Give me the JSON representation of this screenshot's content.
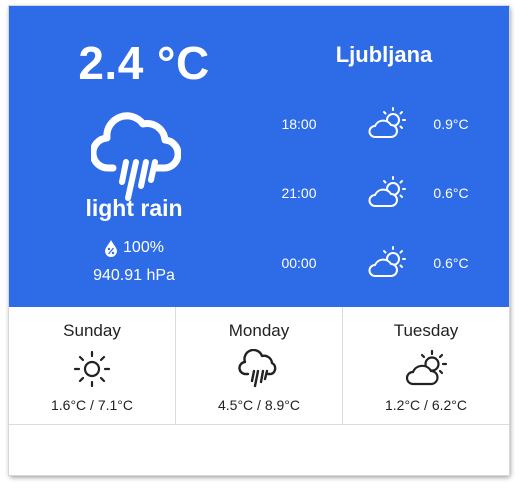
{
  "current": {
    "temperature": "2.4 °C",
    "condition": "light rain",
    "condition_icon": "cloud-rain-icon",
    "humidity": "100%",
    "humidity_icon": "humidity-drop-icon",
    "pressure": "940.91 hPa"
  },
  "location": {
    "city": "Ljubljana"
  },
  "hourly": [
    {
      "time": "18:00",
      "icon": "partly-cloudy-icon",
      "temp": "0.9°C"
    },
    {
      "time": "21:00",
      "icon": "partly-cloudy-icon",
      "temp": "0.6°C"
    },
    {
      "time": "00:00",
      "icon": "partly-cloudy-icon",
      "temp": "0.6°C"
    }
  ],
  "daily": [
    {
      "day": "Sunday",
      "icon": "sun-icon",
      "range": "1.6°C / 7.1°C"
    },
    {
      "day": "Monday",
      "icon": "cloud-rain-icon",
      "range": "4.5°C / 8.9°C"
    },
    {
      "day": "Tuesday",
      "icon": "partly-cloudy-icon",
      "range": "1.2°C / 6.2°C"
    }
  ],
  "colors": {
    "accent": "#2e6be6",
    "text_on_accent": "#ffffff",
    "text_dark": "#222222"
  }
}
